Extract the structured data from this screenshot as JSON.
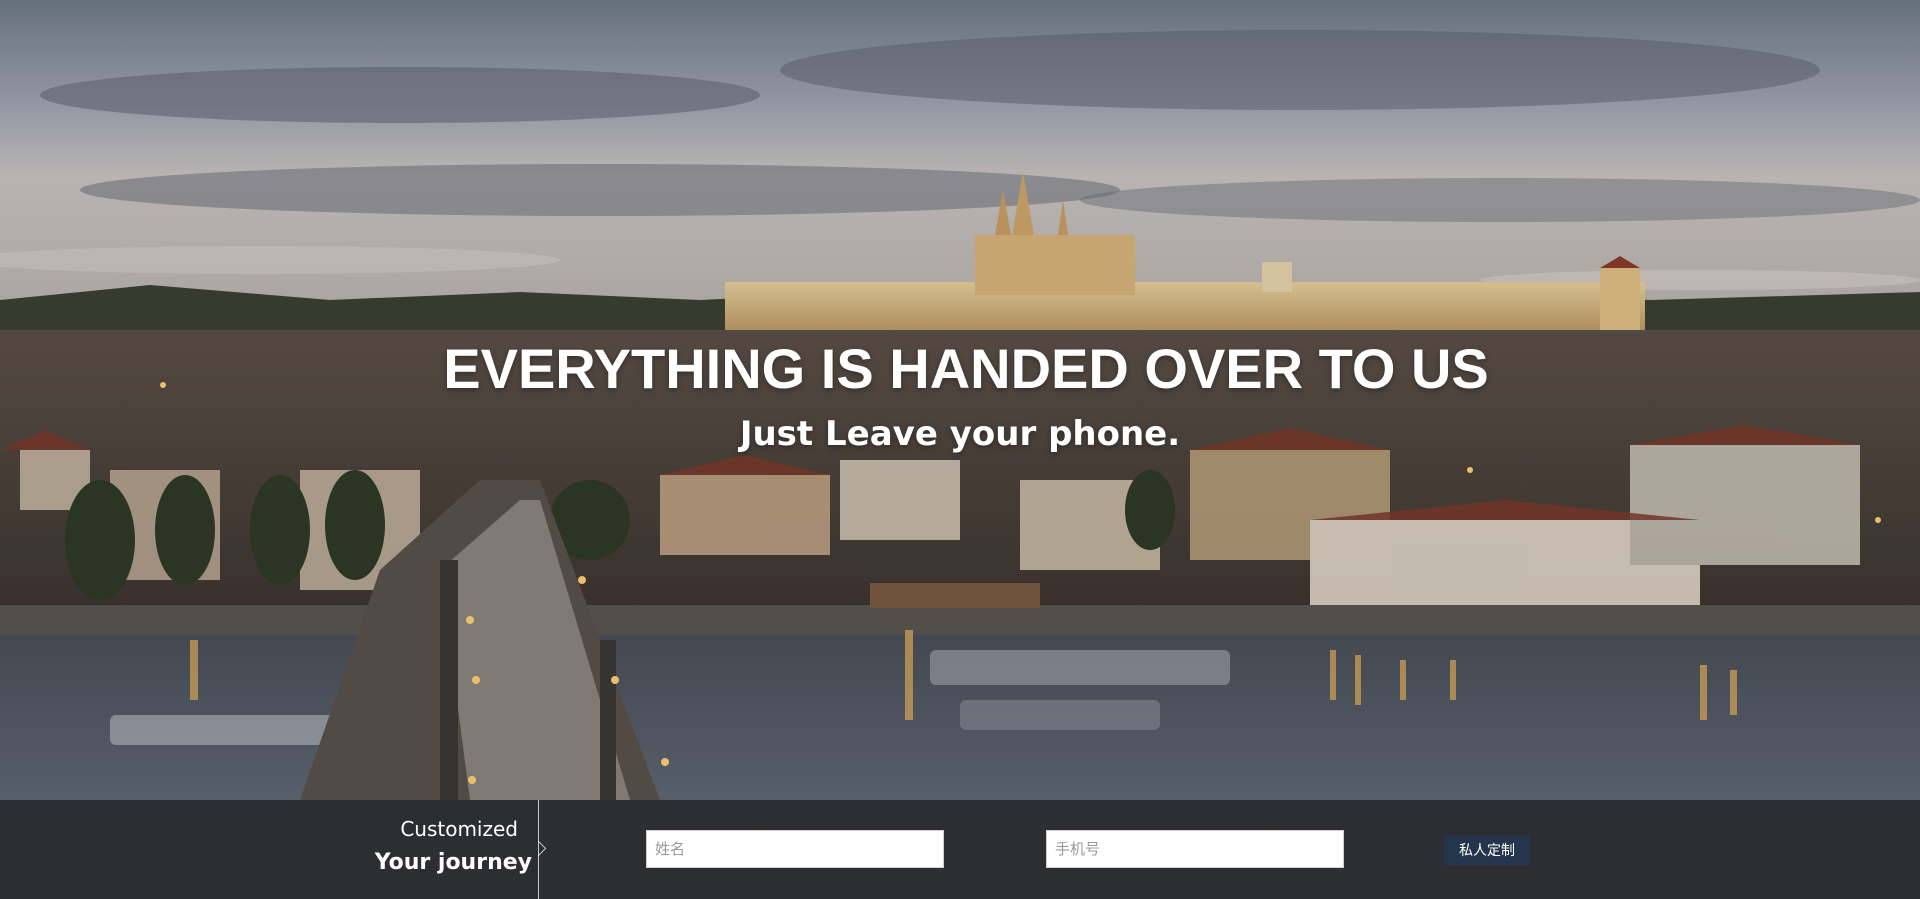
{
  "hero": {
    "headline": "EVERYTHING IS HANDED OVER TO US",
    "subheadline": "Just Leave your phone.",
    "background": "prague-castle-charles-bridge-dusk-photo"
  },
  "form": {
    "journey_line1": "Customized",
    "journey_line2": "Your journey",
    "name_placeholder": "姓名",
    "phone_placeholder": "手机号",
    "submit_label": "私人定制"
  },
  "colors": {
    "bar_background": "#28292b",
    "submit_button": "#24354c",
    "text": "#ffffff"
  }
}
